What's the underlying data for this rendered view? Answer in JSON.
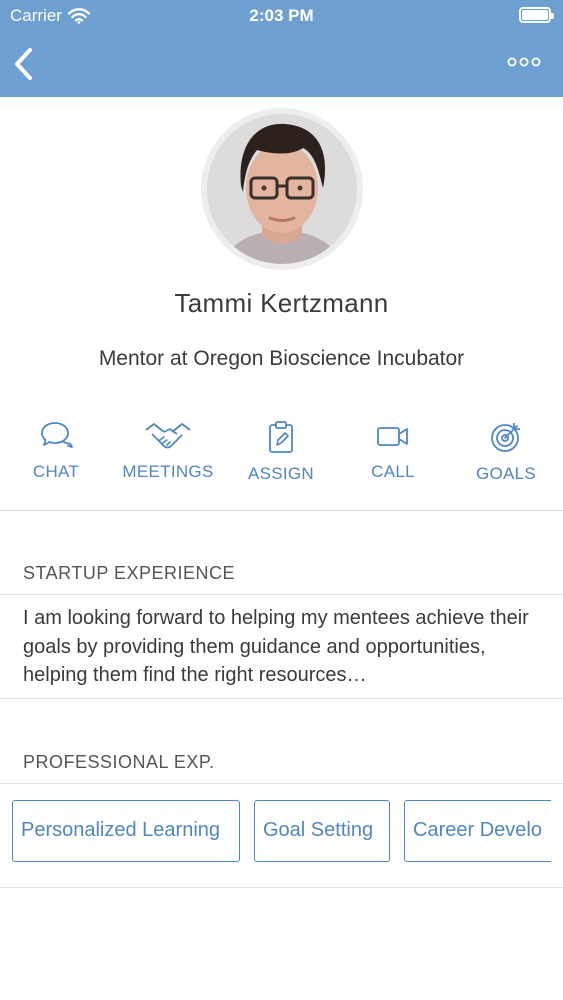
{
  "status_bar": {
    "carrier": "Carrier",
    "time": "2:03 PM"
  },
  "header": {
    "back_icon": "chevron-left-icon",
    "more_icon": "ellipsis-icon"
  },
  "profile": {
    "name": "Tammi Kertzmann",
    "role": "Mentor at Oregon Bioscience Incubator"
  },
  "actions": [
    {
      "label": "CHAT",
      "icon": "chat-bubbles-icon"
    },
    {
      "label": "MEETINGS",
      "icon": "handshake-icon"
    },
    {
      "label": "ASSIGN",
      "icon": "clipboard-icon"
    },
    {
      "label": "CALL",
      "icon": "video-camera-icon"
    },
    {
      "label": "GOALS",
      "icon": "target-icon"
    }
  ],
  "startup_experience": {
    "title": "STARTUP EXPERIENCE",
    "text": "I am looking forward to helping my mentees achieve their goals by providing them guidance and opportunities, helping them find the right resources…"
  },
  "professional_exp": {
    "title": "PROFESSIONAL EXP.",
    "tags": [
      "Personalized Learning",
      "Goal Setting",
      "Career Develo"
    ]
  },
  "colors": {
    "header": "#6d9fd1",
    "accent": "#4f86c6",
    "text": "#3b3b3b",
    "divider": "#e1e1e1"
  }
}
